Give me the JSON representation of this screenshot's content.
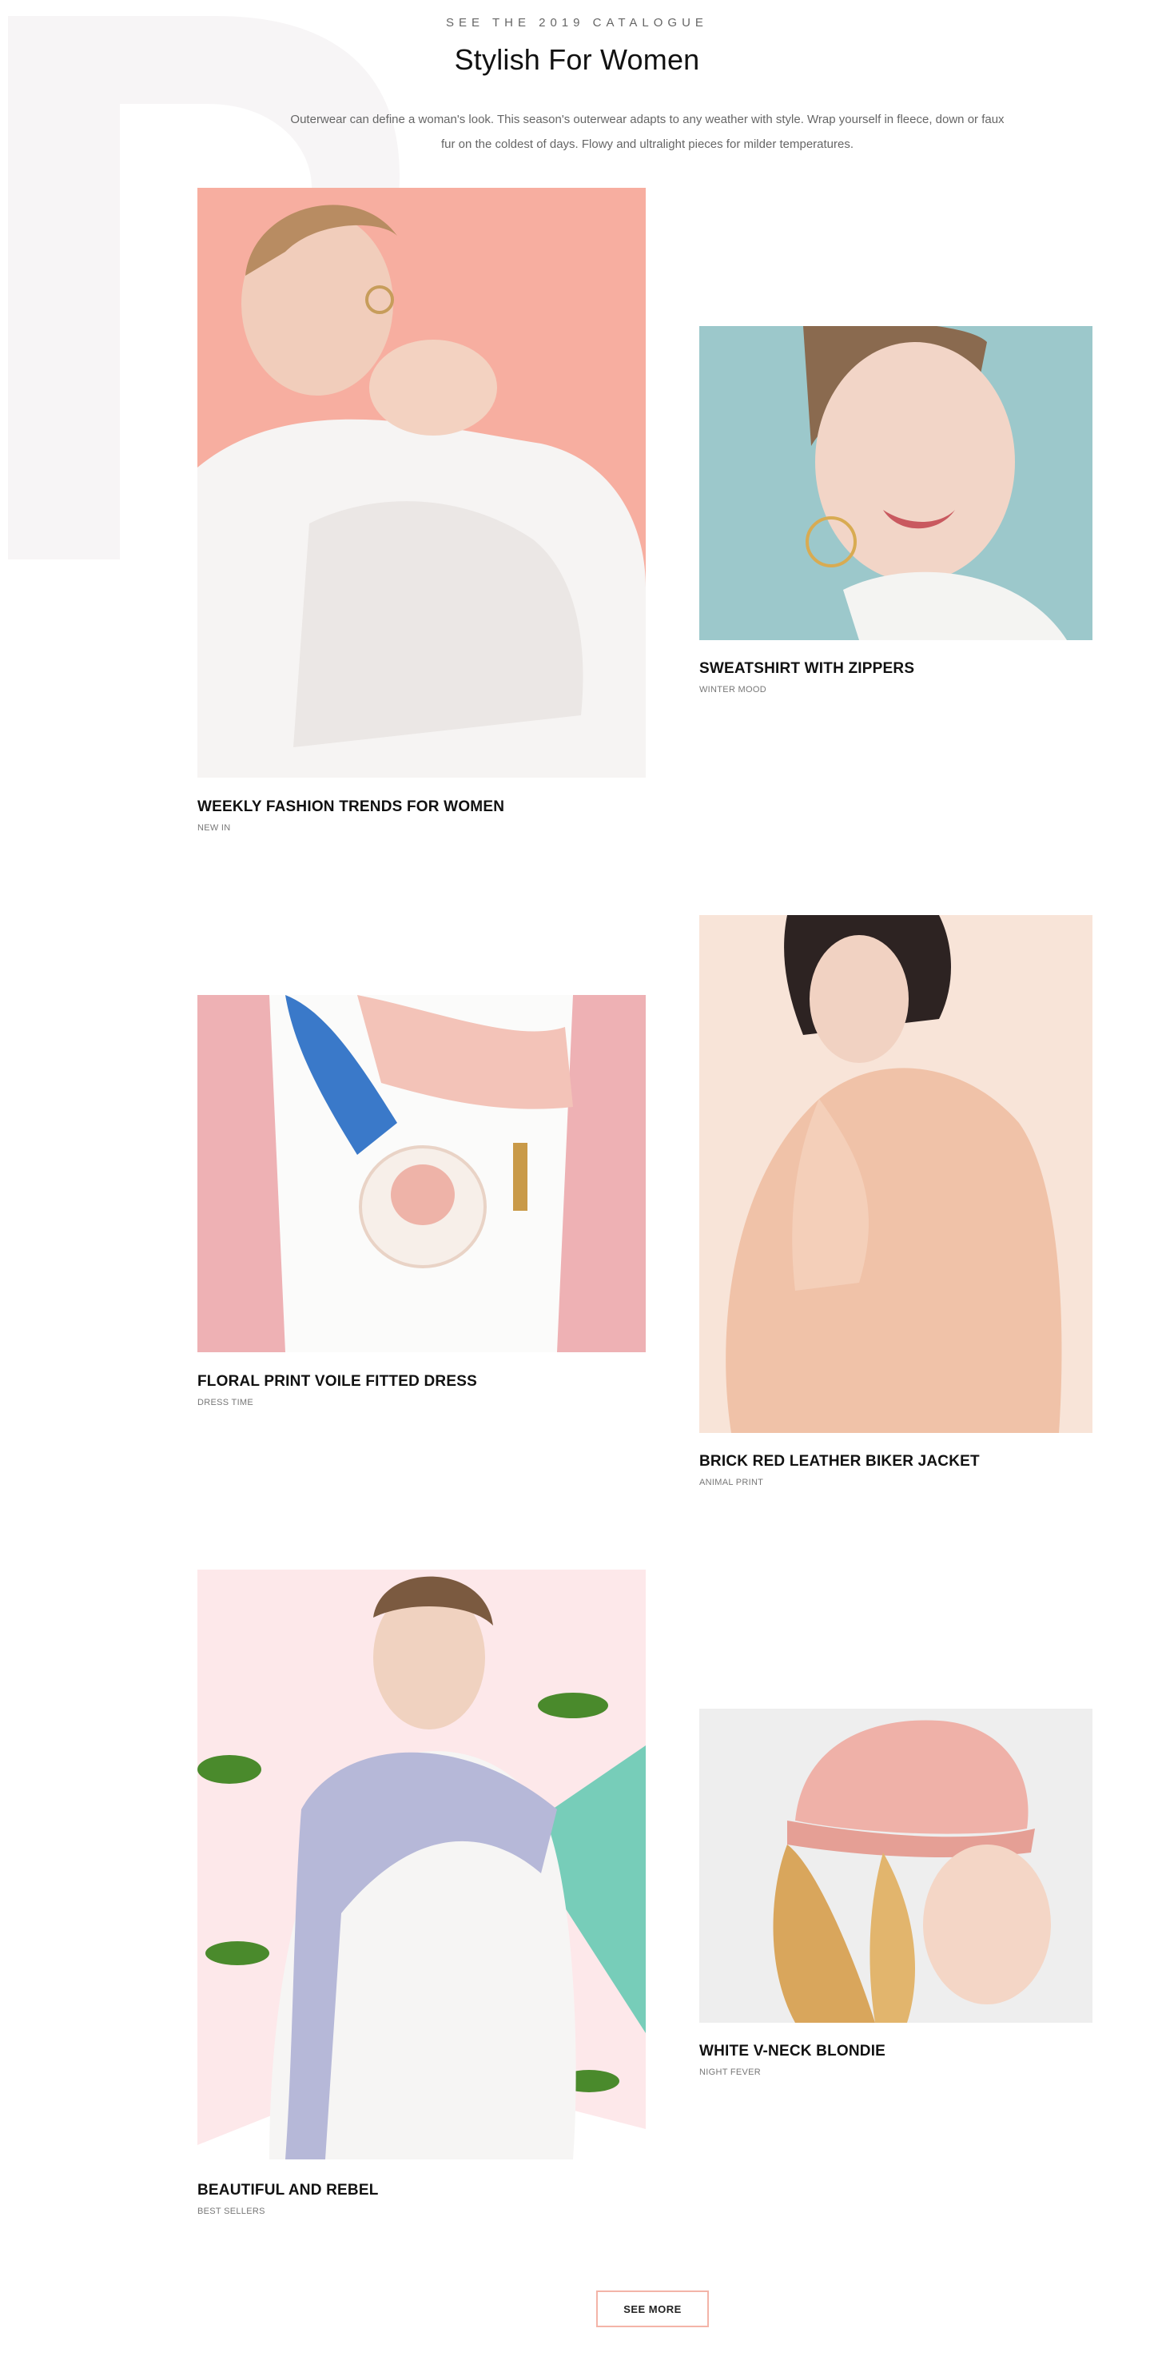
{
  "header": {
    "eyebrow": "SEE THE 2019 CATALOGUE",
    "title": "Stylish For Women",
    "intro": "Outerwear can define a woman's look. This season's outerwear adapts to any weather with style. Wrap yourself in fleece, down or faux fur on the coldest of days. Flowy and ultralight pieces for milder temperatures."
  },
  "cards": [
    {
      "title": "WEEKLY FASHION TRENDS FOR WOMEN",
      "subtitle": "NEW IN",
      "photo_bg": "#f7aea0"
    },
    {
      "title": "SWEATSHIRT WITH ZIPPERS",
      "subtitle": "WINTER MOOD",
      "photo_bg": "#9cc8cb"
    },
    {
      "title": "FLORAL PRINT VOILE FITTED DRESS",
      "subtitle": "DRESS TIME",
      "photo_bg": "#eeb1b4"
    },
    {
      "title": "BRICK RED LEATHER BIKER JACKET",
      "subtitle": "ANIMAL PRINT",
      "photo_bg": "#f8e4d8"
    },
    {
      "title": "BEAUTIFUL AND REBEL",
      "subtitle": "BEST SELLERS",
      "photo_bg": "#fde8ea"
    },
    {
      "title": "WHITE V-NECK BLONDIE",
      "subtitle": "NIGHT FEVER",
      "photo_bg": "#eeeeee"
    }
  ],
  "actions": {
    "see_more": "SEE MORE"
  },
  "colors": {
    "accent_border": "#f3b4a8",
    "watermark": "#f7f5f6"
  }
}
